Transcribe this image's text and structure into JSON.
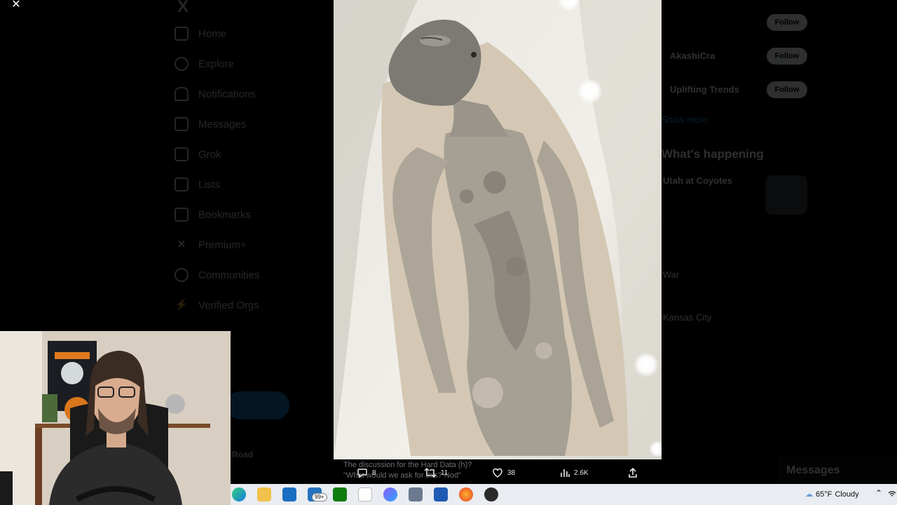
{
  "viewer": {
    "close_glyph": "✕"
  },
  "nav": {
    "logo": "X",
    "items": [
      {
        "label": "Home",
        "icon": "home-icon"
      },
      {
        "label": "Explore",
        "icon": "search-icon"
      },
      {
        "label": "Notifications",
        "icon": "bell-icon"
      },
      {
        "label": "Messages",
        "icon": "mail-icon"
      },
      {
        "label": "Grok",
        "icon": "grok-icon"
      },
      {
        "label": "Lists",
        "icon": "list-icon"
      },
      {
        "label": "Bookmarks",
        "icon": "bookmark-icon"
      },
      {
        "label": "Premium+",
        "icon": "x-icon"
      },
      {
        "label": "Communities",
        "icon": "people-icon"
      },
      {
        "label": "Verified Orgs",
        "icon": "lightning-icon"
      }
    ],
    "profile_name": "Road"
  },
  "sidebar": {
    "who_to_follow": [
      {
        "name": "",
        "follow": "Follow"
      },
      {
        "name": "AkashiCra",
        "follow": "Follow"
      },
      {
        "name": "Uplifting Trends",
        "follow": "Follow"
      }
    ],
    "show_more": "Show more",
    "happening_title": "What's happening",
    "trends": [
      "Utah at Coyotes",
      "War",
      "Kansas City"
    ],
    "messages_label": "Messages"
  },
  "caption": {
    "line1": "The discussion for the Hard Data (h)?",
    "line2": "\"What would we ask for this? Nod\""
  },
  "actions": {
    "replies": "8",
    "reposts": "11",
    "likes": "38",
    "views": "2.6K"
  },
  "taskbar": {
    "badge": "99+",
    "weather_temp": "65°F",
    "weather_text": "Cloudy"
  },
  "colors": {
    "accent": "#1d9bf0",
    "background": "#000000",
    "taskbar": "#e9ecf1"
  }
}
